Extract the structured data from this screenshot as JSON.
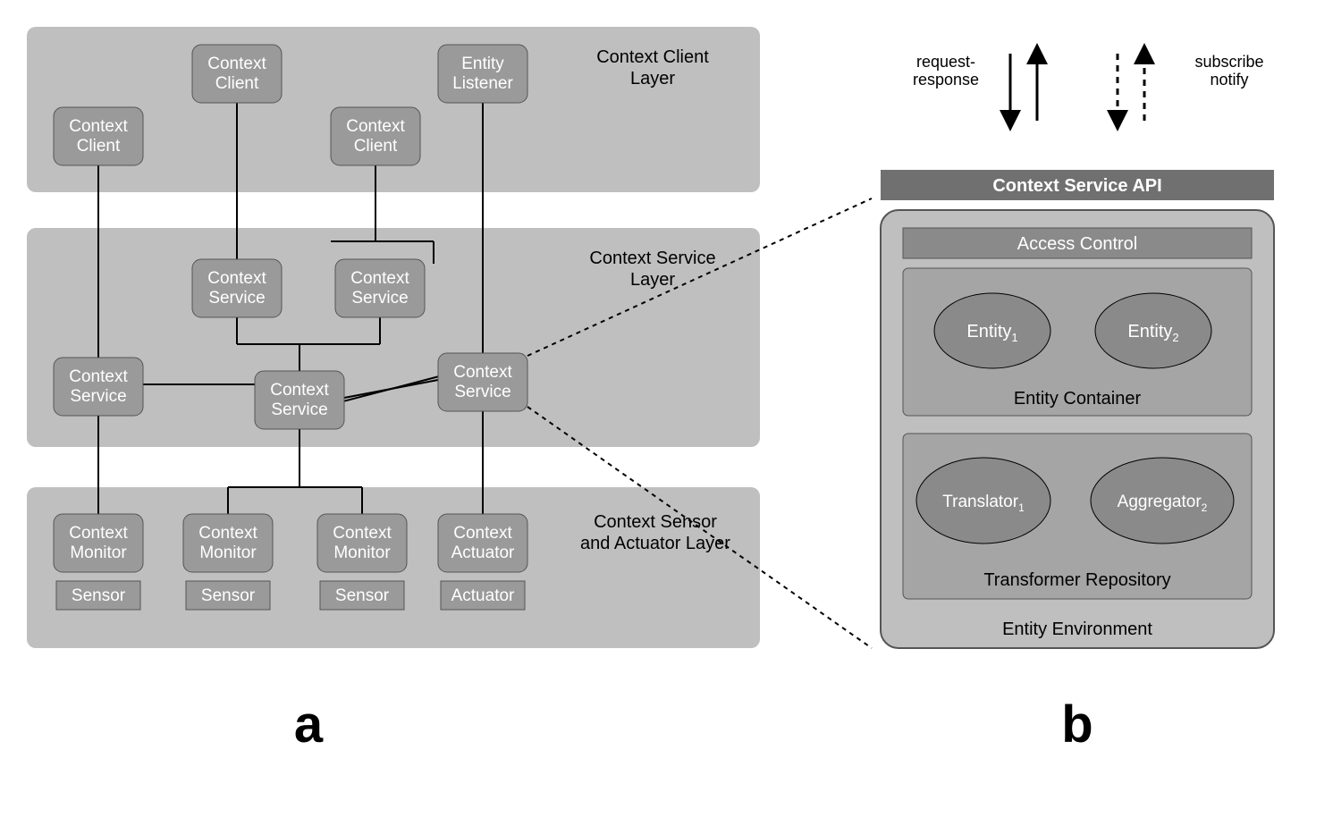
{
  "panelA": {
    "label": "a",
    "layers": {
      "client": "Context Client\nLayer",
      "service": "Context Service\nLayer",
      "sensor": "Context Sensor\nand Actuator Layer"
    },
    "nodes": {
      "clientA": "Context\nClient",
      "clientB": "Context\nClient",
      "clientC": "Context\nClient",
      "entityListener": "Entity\nListener",
      "service1": "Context\nService",
      "service2": "Context\nService",
      "service3": "Context\nService",
      "service4": "Context\nService",
      "service5": "Context\nService",
      "monitor1": "Context\nMonitor",
      "monitor2": "Context\nMonitor",
      "monitor3": "Context\nMonitor",
      "actuator": "Context\nActuator",
      "sensor1": "Sensor",
      "sensor2": "Sensor",
      "sensor3": "Sensor",
      "actuatorBox": "Actuator"
    }
  },
  "panelB": {
    "label": "b",
    "legend": {
      "reqres": "request-\nresponse",
      "subnotify": "subscribe\nnotify"
    },
    "api": "Context Service API",
    "env": {
      "title": "Entity Environment",
      "access": "Access Control",
      "container": {
        "title": "Entity Container",
        "e1": "Entity",
        "e1sub": "1",
        "e2": "Entity",
        "e2sub": "2"
      },
      "repo": {
        "title": "Transformer Repository",
        "t1": "Translator",
        "t1sub": "1",
        "t2": "Aggregator",
        "t2sub": "2"
      }
    }
  }
}
